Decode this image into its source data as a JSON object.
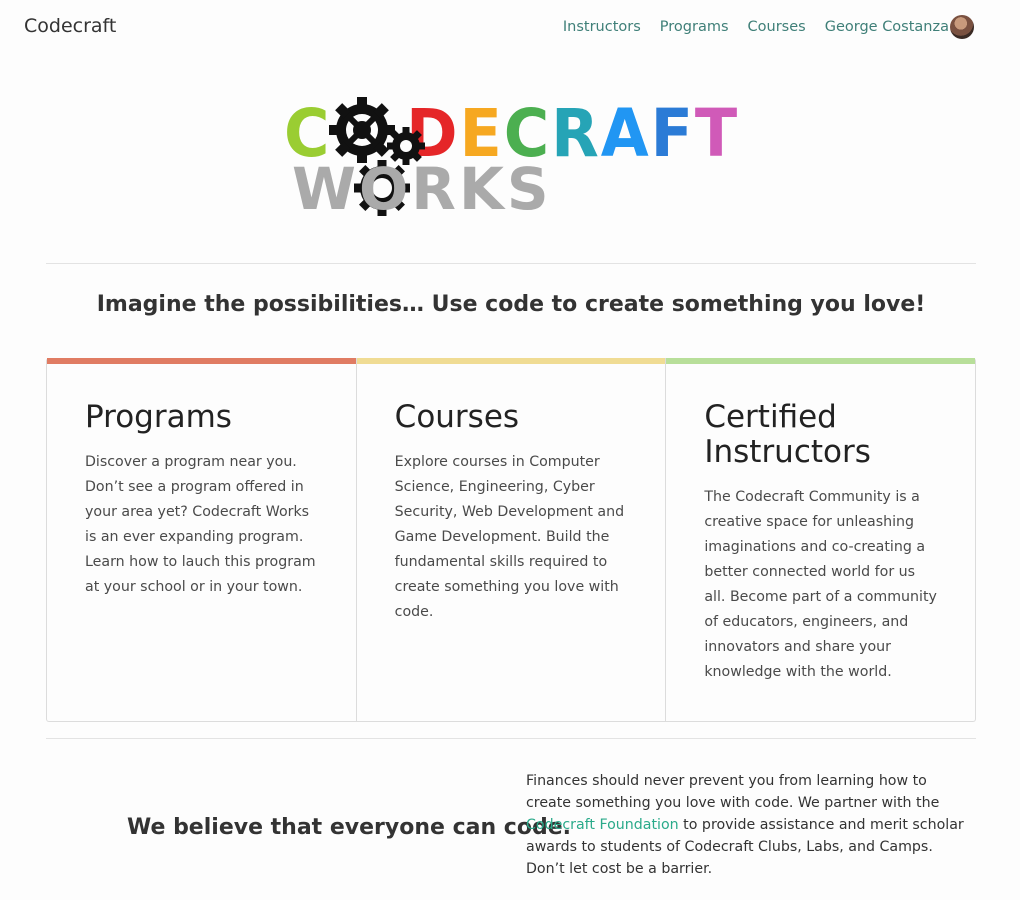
{
  "navbar": {
    "brand": "Codecraft",
    "links": [
      "Instructors",
      "Programs",
      "Courses"
    ],
    "user_name": "George Costanza",
    "link_color": "#3f7f78"
  },
  "logo": {
    "line1": [
      "C",
      "O",
      "D",
      "E",
      "C",
      "R",
      "A",
      "F",
      "T"
    ],
    "line1_colors": [
      "#9acd32",
      "#222222",
      "#e52628",
      "#f6a821",
      "#4caf50",
      "#26a4b6",
      "#2196f3",
      "#2b7bd6",
      "#d05ab8"
    ],
    "line2": "WORKS",
    "line2_color": "#aaaaaa",
    "gear_color": "#111111"
  },
  "tagline": "Imagine the possibilities… Use code to create something you love!",
  "cards": [
    {
      "title": "Programs",
      "accent": "#e07c63",
      "text": "Discover a program near you. Don’t see a program offered in your area yet? Codecraft Works is an ever expanding program. Learn how to lauch this program at your school or in your town."
    },
    {
      "title": "Courses",
      "accent": "#f0dc94",
      "text": "Explore courses in Computer Science, Engineering, Cyber Security, Web Development and Game Development. Build the fundamental skills required to create something you love with code."
    },
    {
      "title": "Certified Instructors",
      "accent": "#b8df9a",
      "text": "The Codecraft Community is a creative space for unleashing imaginations and co-creating a better connected world for us all. Become part of a community of educators, engineers, and innovators and share your knowledge with the world."
    }
  ],
  "believe": "We believe that everyone can code.",
  "finance": {
    "before": "Finances should never prevent you from learning how to create something you love with code. We partner with the ",
    "link": "Codecraft Foundation",
    "after": " to provide assistance and merit scholar awards to students of Codecraft Clubs, Labs, and Camps. Don’t let cost be a barrier.",
    "link_color": "#2aaa8a"
  }
}
